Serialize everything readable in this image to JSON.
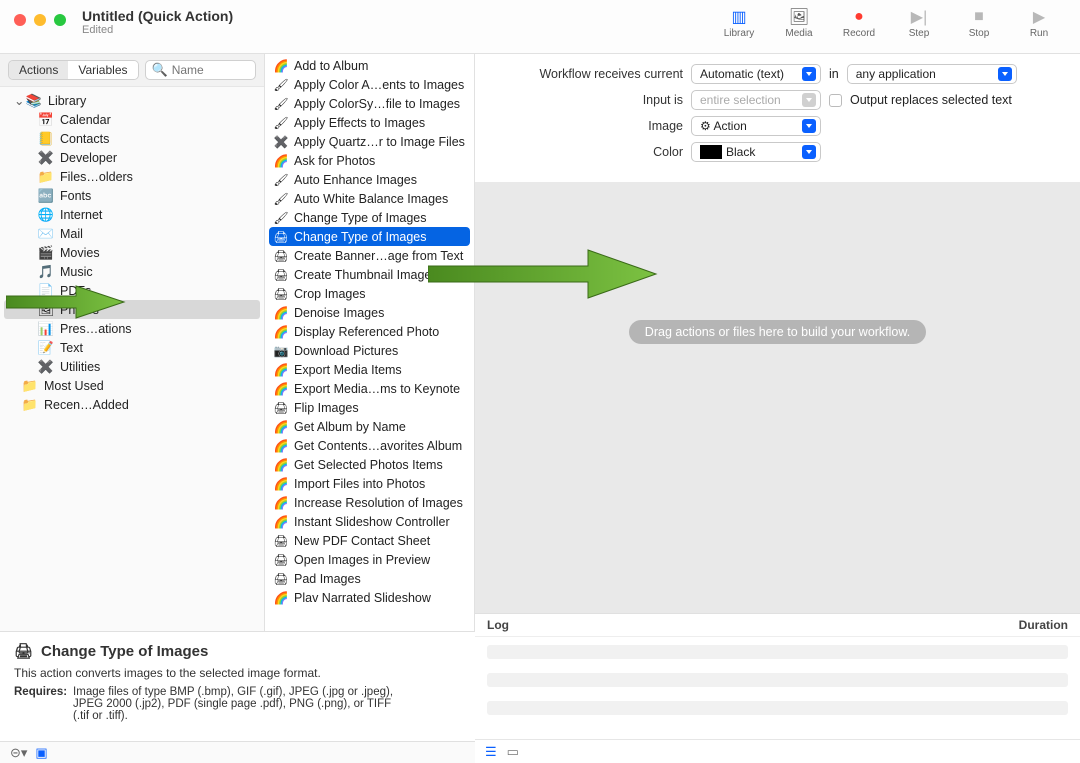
{
  "window": {
    "title": "Untitled (Quick Action)",
    "subtitle": "Edited"
  },
  "toolbar": {
    "library": "Library",
    "media": "Media",
    "record": "Record",
    "step": "Step",
    "stop": "Stop",
    "run": "Run"
  },
  "segmented": {
    "actions": "Actions",
    "variables": "Variables"
  },
  "search": {
    "placeholder": "Name"
  },
  "library": {
    "root": "Library",
    "items": [
      {
        "label": "Calendar",
        "icon": "📅"
      },
      {
        "label": "Contacts",
        "icon": "📒"
      },
      {
        "label": "Developer",
        "icon": "✖️"
      },
      {
        "label": "Files…olders",
        "icon": "📁"
      },
      {
        "label": "Fonts",
        "icon": "🔤"
      },
      {
        "label": "Internet",
        "icon": "🌐"
      },
      {
        "label": "Mail",
        "icon": "✉️"
      },
      {
        "label": "Movies",
        "icon": "🎬"
      },
      {
        "label": "Music",
        "icon": "🎵"
      },
      {
        "label": "PDFs",
        "icon": "📄"
      },
      {
        "label": "Photos",
        "icon": "🖼",
        "selected": true
      },
      {
        "label": "Pres…ations",
        "icon": "📊"
      },
      {
        "label": "Text",
        "icon": "📝"
      },
      {
        "label": "Utilities",
        "icon": "✖️"
      }
    ],
    "extras": [
      {
        "label": "Most Used",
        "icon": "📁"
      },
      {
        "label": "Recen…Added",
        "icon": "📁"
      }
    ]
  },
  "actions": [
    {
      "l": "Add to Album",
      "i": "🌈"
    },
    {
      "l": "Apply Color A…ents to Images",
      "i": "🖌"
    },
    {
      "l": "Apply ColorSy…file to Images",
      "i": "🖌"
    },
    {
      "l": "Apply Effects to Images",
      "i": "🖌"
    },
    {
      "l": "Apply Quartz…r to Image Files",
      "i": "✖️"
    },
    {
      "l": "Ask for Photos",
      "i": "🌈"
    },
    {
      "l": "Auto Enhance Images",
      "i": "🖌"
    },
    {
      "l": "Auto White Balance Images",
      "i": "🖌"
    },
    {
      "l": "Change Type of Images",
      "i": "🖌"
    },
    {
      "l": "Change Type of Images",
      "i": "🖨",
      "selected": true
    },
    {
      "l": "Create Banner…age from Text",
      "i": "🖨"
    },
    {
      "l": "Create Thumbnail Images",
      "i": "🖨"
    },
    {
      "l": "Crop Images",
      "i": "🖨"
    },
    {
      "l": "Denoise Images",
      "i": "🌈"
    },
    {
      "l": "Display Referenced Photo",
      "i": "🌈"
    },
    {
      "l": "Download Pictures",
      "i": "📷"
    },
    {
      "l": "Export Media Items",
      "i": "🌈"
    },
    {
      "l": "Export Media…ms to Keynote",
      "i": "🌈"
    },
    {
      "l": "Flip Images",
      "i": "🖨"
    },
    {
      "l": "Get Album by Name",
      "i": "🌈"
    },
    {
      "l": "Get Contents…avorites Album",
      "i": "🌈"
    },
    {
      "l": "Get Selected Photos Items",
      "i": "🌈"
    },
    {
      "l": "Import Files into Photos",
      "i": "🌈"
    },
    {
      "l": "Increase Resolution of Images",
      "i": "🌈"
    },
    {
      "l": "Instant Slideshow Controller",
      "i": "🌈"
    },
    {
      "l": "New PDF Contact Sheet",
      "i": "🖨"
    },
    {
      "l": "Open Images in Preview",
      "i": "🖨"
    },
    {
      "l": "Pad Images",
      "i": "🖨"
    },
    {
      "l": "Plav Narrated Slideshow",
      "i": "🌈"
    }
  ],
  "description": {
    "title": "Change Type of Images",
    "body": "This action converts images to the selected image format.",
    "requires_label": "Requires:",
    "requires_text": "Image files of type BMP (.bmp), GIF (.gif), JPEG (.jpg or .jpeg), JPEG 2000 (.jp2), PDF (single page .pdf), PNG (.png), or TIFF (.tif or .tiff)."
  },
  "config": {
    "row1_label": "Workflow receives current",
    "row1_value": "Automatic (text)",
    "row1_mid": "in",
    "row1_app": "any application",
    "row2_label": "Input is",
    "row2_value": "entire selection",
    "row2_check_label": "Output replaces selected text",
    "row3_label": "Image",
    "row3_value": "Action",
    "row4_label": "Color",
    "row4_value": "Black"
  },
  "canvas": {
    "hint": "Drag actions or files here to build your workflow."
  },
  "log": {
    "col1": "Log",
    "col2": "Duration"
  }
}
